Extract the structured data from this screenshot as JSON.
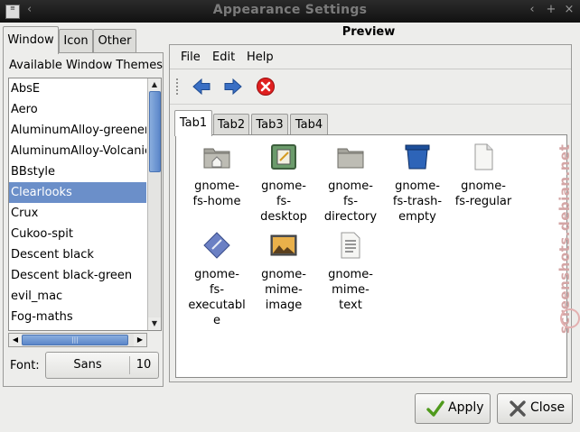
{
  "window": {
    "title": "Appearance Settings",
    "menu_glyph": "‹",
    "min_glyph": "‹",
    "max_glyph": "+",
    "close_glyph": "×"
  },
  "left_tabs": [
    "Window",
    "Icon",
    "Other"
  ],
  "themes": {
    "heading": "Available Window Themes",
    "items": [
      "AbsE",
      "Aero",
      "AluminumAlloy-greener",
      "AluminumAlloy-Volcanic",
      "BBstyle",
      "Clearlooks",
      "Crux",
      "Cukoo-spit",
      "Descent black",
      "Descent black-green",
      "evil_mac",
      "Fog-maths"
    ],
    "selected": "Clearlooks"
  },
  "font": {
    "label": "Font:",
    "name": "Sans",
    "size": "10"
  },
  "preview": {
    "title": "Preview",
    "menu": [
      "File",
      "Edit",
      "Help"
    ],
    "tabs": [
      "Tab1",
      "Tab2",
      "Tab3",
      "Tab4"
    ],
    "icons": [
      {
        "label": "gnome-\nfs-home",
        "icon": "folder-home-icon"
      },
      {
        "label": "gnome-\nfs-\ndesktop",
        "icon": "desktop-icon"
      },
      {
        "label": "gnome-\nfs-\ndirectory",
        "icon": "folder-icon"
      },
      {
        "label": "gnome-\nfs-trash-\nempty",
        "icon": "trash-icon"
      },
      {
        "label": "gnome-\nfs-regular",
        "icon": "file-icon"
      },
      {
        "label": "gnome-\nfs-\nexecutabl\ne",
        "icon": "executable-icon"
      },
      {
        "label": "gnome-\nmime-\nimage",
        "icon": "image-icon"
      },
      {
        "label": "gnome-\nmime-\ntext",
        "icon": "text-file-icon"
      }
    ]
  },
  "buttons": {
    "apply": "Apply",
    "close": "Close"
  },
  "watermark": "screenshots.debian.net",
  "colors": {
    "selection": "#6b8fc9",
    "titlebar": "#1a1a1a"
  }
}
